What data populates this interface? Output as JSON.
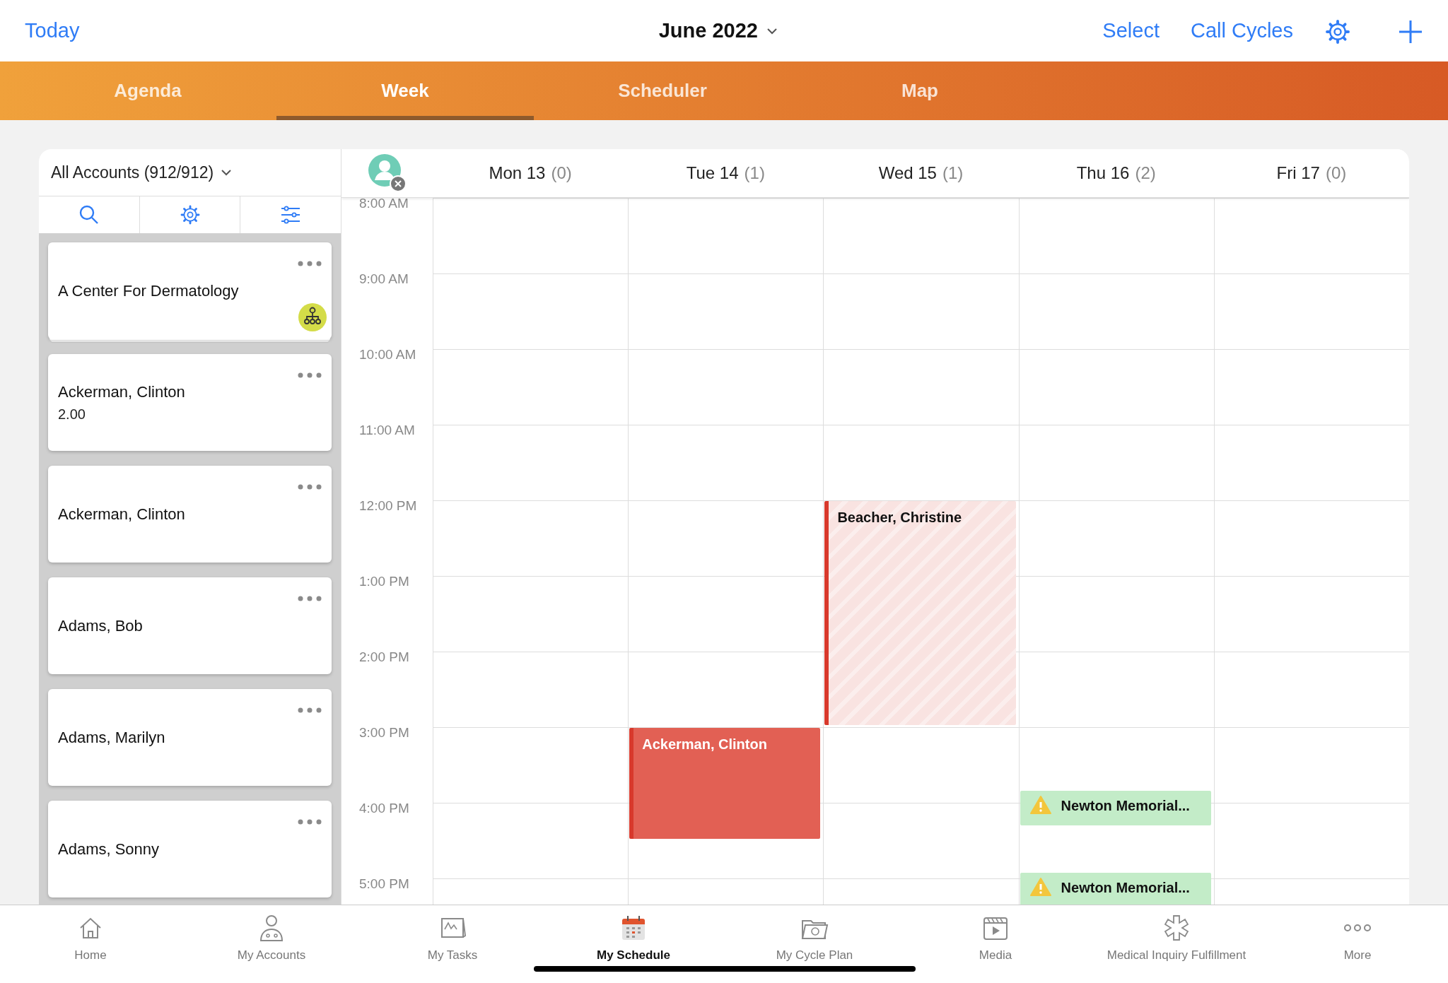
{
  "top_bar": {
    "today": "Today",
    "title": "June 2022",
    "actions": [
      "Select",
      "Call Cycles"
    ]
  },
  "tabs": [
    {
      "label": "Agenda",
      "selected": false
    },
    {
      "label": "Week",
      "selected": true
    },
    {
      "label": "Scheduler",
      "selected": false
    },
    {
      "label": "Map",
      "selected": false
    }
  ],
  "sidebar": {
    "filter": "All Accounts (912/912)",
    "accounts": [
      {
        "name": "A Center For Dermatology",
        "stacked": true,
        "hierarchy": true
      },
      {
        "name": "Ackerman, Clinton",
        "detail": "2.00",
        "stacked": false,
        "hierarchy": false
      },
      {
        "name": "Ackerman, Clinton",
        "stacked": false,
        "hierarchy": false
      },
      {
        "name": "Adams, Bob",
        "stacked": false,
        "hierarchy": false
      },
      {
        "name": "Adams, Marilyn",
        "stacked": false,
        "hierarchy": false
      },
      {
        "name": "Adams, Sonny",
        "stacked": false,
        "hierarchy": false
      }
    ]
  },
  "calendar": {
    "days": [
      {
        "label": "Mon 13",
        "count": "(0)"
      },
      {
        "label": "Tue 14",
        "count": "(1)",
        "events": [
          {
            "title": "Ackerman, Clinton",
            "kind": "submitted"
          }
        ]
      },
      {
        "label": "Wed 15",
        "count": "(1)",
        "events": [
          {
            "title": "Beacher, Christine",
            "kind": "planned"
          }
        ]
      },
      {
        "label": "Thu 16",
        "count": "(2)",
        "events": [
          {
            "title": "Newton Memorial...",
            "kind": "warning"
          },
          {
            "title": "Newton Memorial...",
            "kind": "warning"
          }
        ]
      },
      {
        "label": "Fri 17",
        "count": "(0)"
      }
    ],
    "times": [
      "8:00 AM",
      "9:00 AM",
      "10:00 AM",
      "11:00 AM",
      "12:00 PM",
      "1:00 PM",
      "2:00 PM",
      "3:00 PM",
      "4:00 PM",
      "5:00 PM"
    ]
  },
  "bottom_nav": [
    {
      "label": "Home",
      "selected": false
    },
    {
      "label": "My Accounts",
      "selected": false
    },
    {
      "label": "My Tasks",
      "selected": false
    },
    {
      "label": "My Schedule",
      "selected": true
    },
    {
      "label": "My Cycle Plan",
      "selected": false
    },
    {
      "label": "Media",
      "selected": false
    },
    {
      "label": "Medical Inquiry Fulfillment",
      "selected": false
    },
    {
      "label": "More",
      "selected": false
    }
  ]
}
